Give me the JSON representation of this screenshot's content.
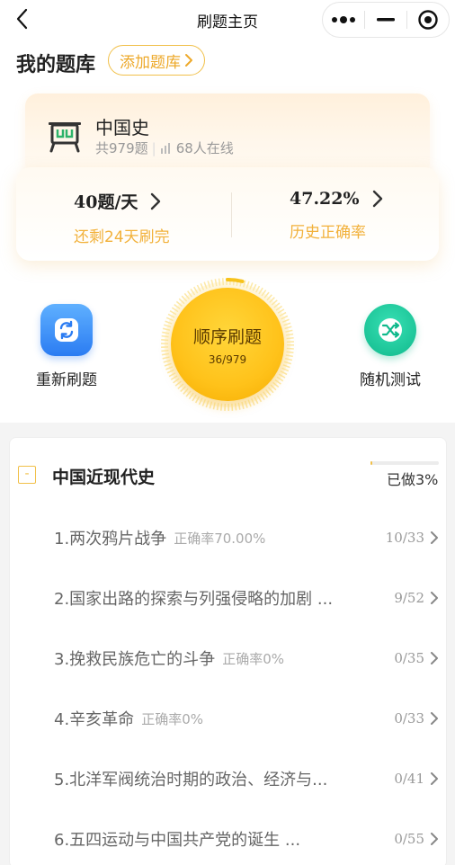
{
  "nav": {
    "title": "刷题主页"
  },
  "header": {
    "title": "我的题库",
    "add_button": "添加题库"
  },
  "subject": {
    "name": "中国史",
    "total": "共979题",
    "online": "68人在线"
  },
  "stats": {
    "daily": {
      "value": "40题/天",
      "label": "还剩24天刷完"
    },
    "accuracy": {
      "value": "47.22%",
      "label": "历史正确率"
    }
  },
  "actions": {
    "restart": "重新刷题",
    "sequential": {
      "title": "顺序刷题",
      "progress": "36/979",
      "fraction": 0.037
    },
    "random": "随机测试"
  },
  "section": {
    "title": "中国近现代史",
    "done_label": "已做3%",
    "done_fraction": 0.03,
    "collapse_symbol": "-"
  },
  "chapters": [
    {
      "title": "1.两次鸦片战争",
      "rate": "正确率70.00%",
      "count": "10/33"
    },
    {
      "title": "2.国家出路的探索与列强侵略的加剧 ...",
      "rate": "",
      "count": "9/52"
    },
    {
      "title": "3.挽救民族危亡的斗争",
      "rate": "正确率0%",
      "count": "0/35"
    },
    {
      "title": "4.辛亥革命",
      "rate": "正确率0%",
      "count": "0/33"
    },
    {
      "title": "5.北洋军阀统治时期的政治、经济与...",
      "rate": "",
      "count": "0/41"
    },
    {
      "title": "6.五四运动与中国共产党的诞生 ...",
      "rate": "",
      "count": "0/55"
    }
  ],
  "colors": {
    "accent": "#f1c049",
    "accent_text": "#f2b13a",
    "primary_button": "#ffc21a"
  },
  "icons": [
    "back-icon",
    "more-icon",
    "minimize-icon",
    "target-icon",
    "chevron-right-icon",
    "subject-icon",
    "signal-icon",
    "refresh-icon",
    "shuffle-icon"
  ]
}
